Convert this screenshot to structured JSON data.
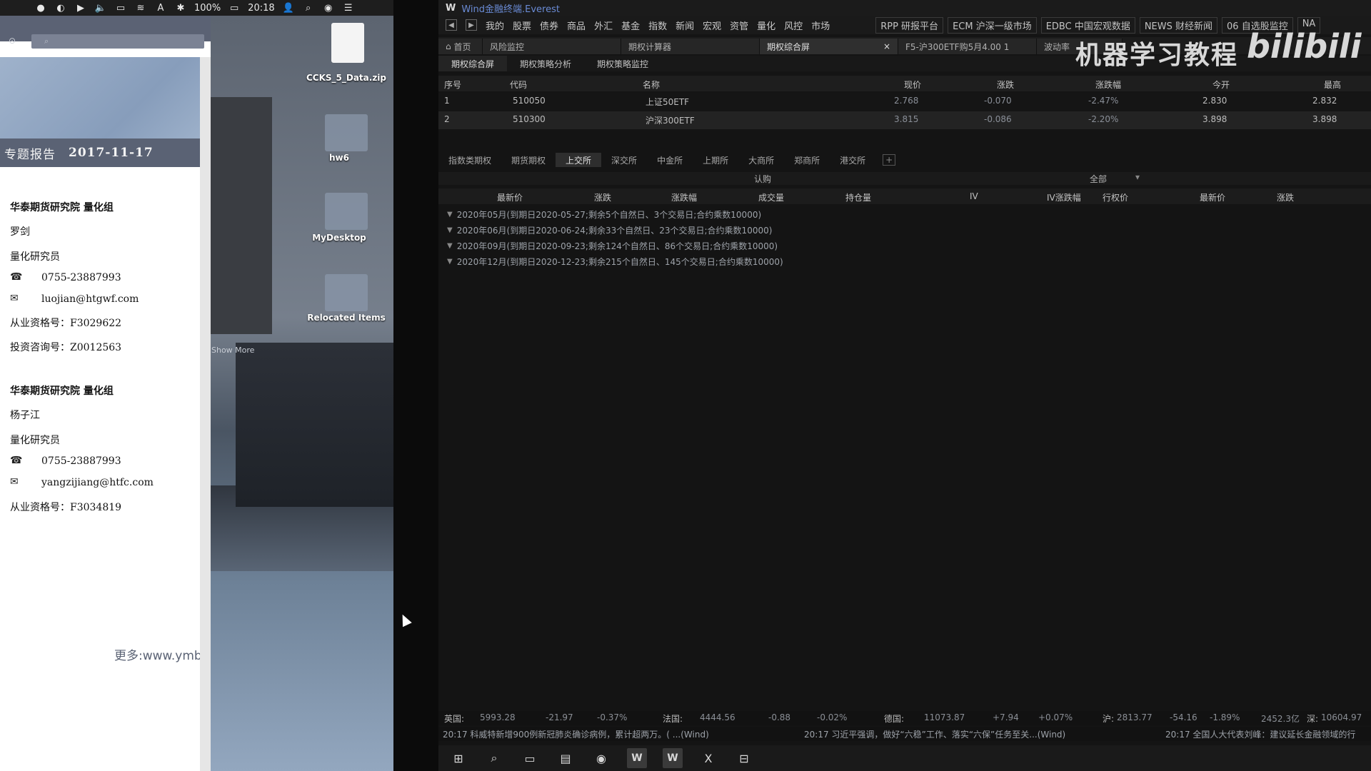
{
  "menubar": {
    "battery": "100%",
    "time": "20:18",
    "input_method": "A"
  },
  "pdf": {
    "cover_title": "专题报告",
    "cover_date": "2017-11-17",
    "author1": {
      "org": "华泰期货研究院 量化组",
      "name": "罗剑",
      "role": "量化研究员",
      "phone": "0755-23887993",
      "email": "luojian@htgwf.com",
      "cert1": "从业资格号：F3029622",
      "cert2": "投资咨询号：Z0012563"
    },
    "author2": {
      "org": "华泰期货研究院 量化组",
      "name": "杨子江",
      "role": "量化研究员",
      "phone": "0755-23887993",
      "email": "yangzijiang@htfc.com",
      "cert1": "从业资格号：F3034819"
    },
    "more_link": "更多:www.ymb.cc"
  },
  "desktop": {
    "icons": [
      {
        "label": "CCKS_5_Data.zip"
      },
      {
        "label": "hw6"
      },
      {
        "label": "MyDesktop"
      },
      {
        "label": "Relocated Items"
      }
    ],
    "show_more": "Show More"
  },
  "wind": {
    "title": "Wind金融终端.Everest",
    "menu": [
      "我的",
      "股票",
      "债券",
      "商品",
      "外汇",
      "基金",
      "指数",
      "新闻",
      "宏观",
      "资管",
      "量化",
      "风控",
      "市场"
    ],
    "menu_right": [
      "RPP 研报平台",
      "ECM 沪深一级市场",
      "EDBC 中国宏观数据",
      "NEWS 财经新闻",
      "06 自选股监控",
      "NA"
    ],
    "tabs": [
      "首页",
      "风险监控",
      "期权计算器",
      "期权综合屏",
      "F5-沪300ETF购5月4.00 1",
      "波动率"
    ],
    "subtabs": [
      "期权综合屏",
      "期权策略分析",
      "期权策略监控"
    ],
    "quote_headers": [
      "序号",
      "代码",
      "名称",
      "现价",
      "涨跌",
      "涨跌幅",
      "今开",
      "最高"
    ],
    "quote_rows": [
      {
        "no": "1",
        "code": "510050",
        "name": "上证50ETF",
        "price": "2.768",
        "chg": "-0.070",
        "pct": "-2.47%",
        "open": "2.830",
        "high": "2.832"
      },
      {
        "no": "2",
        "code": "510300",
        "name": "沪深300ETF",
        "price": "3.815",
        "chg": "-0.086",
        "pct": "-2.20%",
        "open": "3.898",
        "high": "3.898"
      }
    ],
    "exchanges": [
      "指数类期权",
      "期货期权",
      "上交所",
      "深交所",
      "中金所",
      "上期所",
      "大商所",
      "郑商所",
      "港交所"
    ],
    "active_exchange_index": 2,
    "rengou_label": "认购",
    "filter_label": "全部",
    "option_headers": [
      "最新价",
      "涨跌",
      "涨跌幅",
      "成交量",
      "持仓量",
      "IV",
      "IV涨跌幅",
      "行权价",
      "最新价",
      "涨跌"
    ],
    "expiries": [
      "2020年05月(到期日2020-05-27;剩余5个自然日、3个交易日;合约乘数10000)",
      "2020年06月(到期日2020-06-24;剩余33个自然日、23个交易日;合约乘数10000)",
      "2020年09月(到期日2020-09-23;剩余124个自然日、86个交易日;合约乘数10000)",
      "2020年12月(到期日2020-12-23;剩余215个自然日、145个交易日;合约乘数10000)"
    ],
    "ticker1": {
      "uk_label": "英国:",
      "uk_val": "5993.28",
      "uk_chg": "-21.97",
      "uk_pct": "-0.37%",
      "fr_label": "法国:",
      "fr_val": "4444.56",
      "fr_chg": "-0.88",
      "fr_pct": "-0.02%",
      "de_label": "德国:",
      "de_val": "11073.87",
      "de_chg": "+7.94",
      "de_pct": "+0.07%",
      "sh_label": "沪:",
      "sh_val": "2813.77",
      "sh_chg": "-54.16",
      "sh_pct": "-1.89%",
      "sh_amt": "2452.3亿",
      "sz_label": "深:",
      "sz_val": "10604.97"
    },
    "ticker2": [
      "20:17 科威特新增900例新冠肺炎确诊病例，累计超两万。( ...(Wind)",
      "20:17 习近平强调，做好“六稳”工作、落实“六保”任务至关...(Wind)",
      "20:17 全国人大代表刘峰：建议延长金融领域的行"
    ]
  },
  "watermark": {
    "text": "机器学习教程",
    "logo": "bilibili"
  }
}
